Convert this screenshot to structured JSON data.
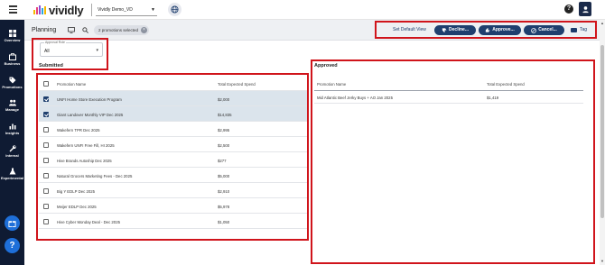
{
  "header": {
    "logo_text": "vividly",
    "logo_colors": [
      "#f5b700",
      "#e8417a",
      "#8a4fd6",
      "#2aa6de"
    ],
    "environment": "Vividly Demo_VD",
    "help_label": "?"
  },
  "sidebar": {
    "items": [
      {
        "label": "Overview",
        "icon": "overview-grid-icon"
      },
      {
        "label": "Business",
        "icon": "business-icon"
      },
      {
        "label": "Promotions",
        "icon": "tag-icon"
      },
      {
        "label": "Manage",
        "icon": "people-icon"
      },
      {
        "label": "Insights",
        "icon": "bar-chart-icon"
      },
      {
        "label": "Internal",
        "icon": "tools-icon"
      },
      {
        "label": "Experimental",
        "icon": "flask-icon"
      }
    ],
    "bottom_help": "?"
  },
  "toolbar": {
    "title": "Planning",
    "selection_chip": "2 promotions selected",
    "set_default_view": "Set Default View",
    "decline_label": "Decline...",
    "approve_label": "Approve...",
    "cancel_label": "Cancel...",
    "tag_label": "Tag"
  },
  "filters": {
    "approval_role_label": "Approval Role",
    "approval_role_value": "All"
  },
  "submitted": {
    "title": "Submitted",
    "columns": [
      "Promotion Name",
      "Total Expected Spend"
    ],
    "rows": [
      {
        "name": "UNFI Home Store Execution Program",
        "spend": "$2,000",
        "checked": true
      },
      {
        "name": "Giant Landover Monthly VIP Dec 2025",
        "spend": "$14,835",
        "checked": true
      },
      {
        "name": "Wakefern TPR Dec 2025",
        "spend": "$2,995",
        "checked": false
      },
      {
        "name": "Wakefern UNFI Free Fill, HI 2025",
        "spend": "$2,500",
        "checked": false
      },
      {
        "name": "Hive Brands Autoship Dec 2025",
        "spend": "$277",
        "checked": false
      },
      {
        "name": "Natural Grocers Marketing Fees - Dec 2025",
        "spend": "$5,000",
        "checked": false
      },
      {
        "name": "Big Y EDLP Dec 2025",
        "spend": "$2,910",
        "checked": false
      },
      {
        "name": "Meijer EDLP Dec 2025",
        "spend": "$5,978",
        "checked": false
      },
      {
        "name": "Hive Cyber Monday Deal - Dec 2025",
        "spend": "$1,050",
        "checked": false
      }
    ]
  },
  "approved": {
    "title": "Approved",
    "columns": [
      "Promotion Name",
      "Total Expected Spend"
    ],
    "rows": [
      {
        "name": "Mid Atlantic Beef Jerky Buys + AO Jan 2025",
        "spend": "$1,419"
      }
    ]
  }
}
